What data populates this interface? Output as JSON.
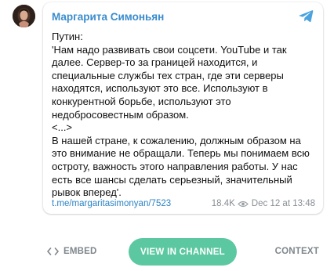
{
  "post": {
    "author": "Маргарита Симоньян",
    "lines": [
      "Путин:",
      "'Нам надо развивать свои соцсети. YouTube и так",
      "далее. Сервер-то за границей находится, и",
      "специальные службы тех стран, где эти серверы",
      "находятся, используют это все. Используют в",
      "конкурентной борьбе, используют это",
      "недобросовестным образом.",
      "<...>",
      "В нашей стране, к сожалению, должным образом на",
      "это внимание не обращали. Теперь мы понимаем всю",
      "остроту, важность этого направления работы. У нас",
      "есть все шансы сделать серьезный, значительный",
      "рывок вперед'."
    ],
    "link": "t.me/margaritasimonyan/7523",
    "views": "18.4K",
    "date": "Dec 12 at 13:48"
  },
  "icons": {
    "avatar": "avatar-photo",
    "telegram": "telegram-paper-plane-icon",
    "views": "eye-icon",
    "embed": "code-brackets-icon"
  },
  "footer": {
    "embed_label": "EMBED",
    "view_channel_label": "VIEW IN CHANNEL",
    "context_label": "CONTEXT"
  },
  "colors": {
    "author": "#3a8ccd",
    "link": "#2c83c4",
    "button_bg": "#5cc8a2",
    "telegram_icon": "#4aa3df",
    "muted": "#7f868c"
  }
}
